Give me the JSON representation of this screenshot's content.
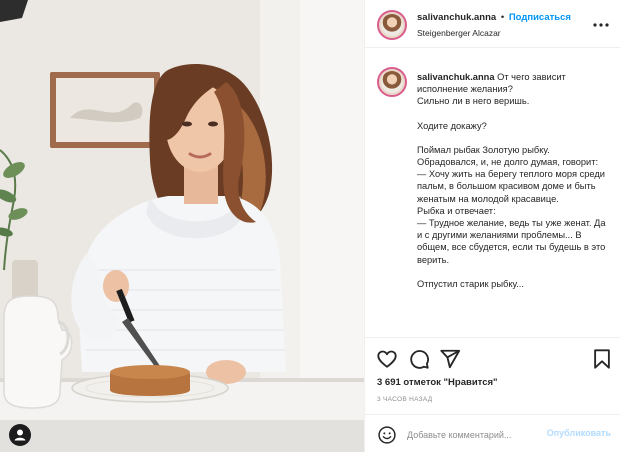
{
  "post": {
    "username": "salivanchuk.anna",
    "dot": "•",
    "follow_label": "Подписаться",
    "location": "Steigenberger Alcazar",
    "more_icon": "more-horizontal-icon"
  },
  "caption": {
    "username": "salivanchuk.anna",
    "lines": [
      "От чего зависит исполнение желания?",
      "Сильно ли в него веришь.",
      "",
      "Ходите докажу?",
      "",
      "Поймал рыбак Золотую рыбку. Обрадовался, и, не долго думая, говорит:",
      "— Хочу жить на берегу теплого моря среди пальм, в большом красивом доме и быть женатым на молодой красавице.",
      "Рыбка и отвечает:",
      "— Трудное желание, ведь ты уже женат. Да и с другими желаниями проблемы... В общем, все сбудется, если ты будешь в это верить.",
      "",
      "Отпустил старик рыбку..."
    ]
  },
  "actions": {
    "icons": [
      "heart-icon",
      "comment-icon",
      "share-icon",
      "bookmark-icon"
    ]
  },
  "likes_text": "3 691 отметок \"Нравится\"",
  "time_text": "3 часов назад",
  "comment_box": {
    "placeholder": "Добавьте комментарий...",
    "post_label": "Опубликовать"
  },
  "colors": {
    "accent": "#0095f6",
    "post_disabled": "#b3dbff",
    "ring": "#d95d8d"
  }
}
